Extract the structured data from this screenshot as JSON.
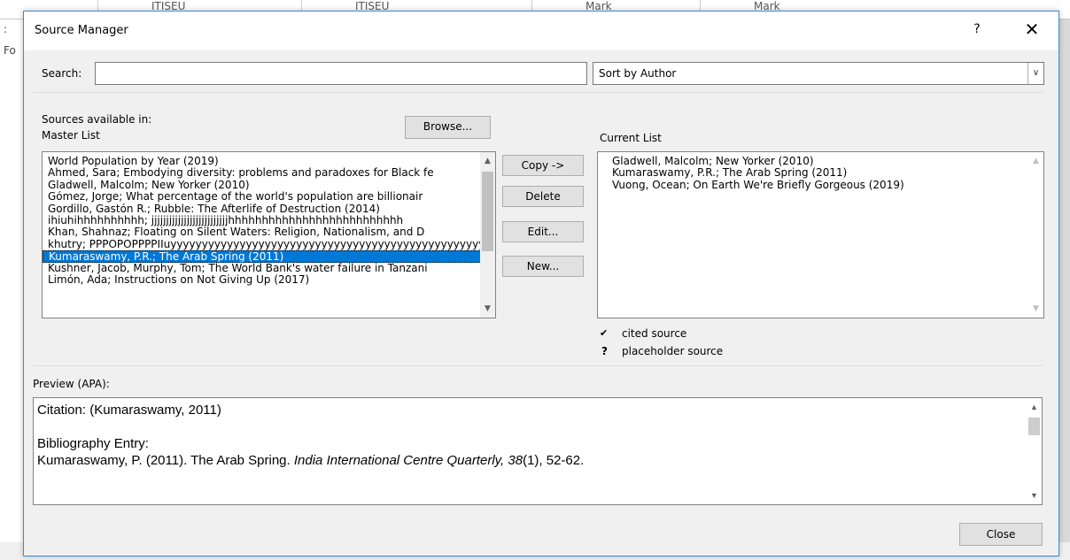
{
  "background": {
    "header_cells": [
      "ITISEU",
      "ITISEU",
      "Mark",
      "Mark"
    ],
    "left_letters": [
      ":",
      "Fo"
    ]
  },
  "dialog": {
    "title": "Source Manager",
    "help": "?",
    "close_glyph": "✕"
  },
  "search": {
    "label": "Search:",
    "value": "",
    "placeholder": ""
  },
  "sort": {
    "selected": "Sort by Author"
  },
  "master": {
    "sources_label": "Sources available in:",
    "list_label": "Master List",
    "browse_button": "Browse...",
    "items": [
      "World Population by Year (2019)",
      "Ahmed, Sara; Embodying diversity: problems and paradoxes for Black fe",
      "Gladwell, Malcolm; New Yorker (2010)",
      "Gómez, Jorge; What percentage of the world's population are billionair",
      "Gordillo, Gastón R.; Rubble: The Afterlife of Destruction (2014)",
      "ihiuhihhhhhhhhhh; jjjjjjjjjjjjjjjjjjjjjjjjjjhhhhhhhhhhhhhhhhhhhhhhhhhh",
      "Khan, Shahnaz; Floating on Silent Waters: Religion, Nationalism, and D",
      "khutry; PPPOPOPPPPIIuyyyyyyyyyyyyyyyyyyyyyyyyyyyyyyyyyyyyyyyyyyyyyyyyyy",
      "Kumaraswamy, P.R.; The Arab Spring (2011)",
      "Kushner, Jacob, Murphy, Tom; The World Bank's water failure in Tanzani",
      "Limón, Ada; Instructions on Not Giving Up (2017)"
    ],
    "selected_index": 8
  },
  "actions": {
    "copy": "Copy ->",
    "delete": "Delete",
    "edit": "Edit...",
    "new": "New..."
  },
  "current": {
    "list_label": "Current List",
    "items": [
      "Gladwell, Malcolm; New Yorker (2010)",
      "Kumaraswamy, P.R.; The Arab Spring (2011)",
      "Vuong, Ocean; On Earth We're Briefly Gorgeous (2019)"
    ]
  },
  "legend": {
    "cited_symbol": "✔",
    "cited_label": "cited source",
    "placeholder_symbol": "?",
    "placeholder_label": "placeholder source"
  },
  "preview": {
    "label": "Preview (APA):",
    "citation": "Citation:  (Kumaraswamy, 2011)",
    "bibliography_heading": "Bibliography Entry:",
    "entry_prefix": "Kumaraswamy, P. (2011). The Arab Spring. ",
    "entry_journal": "India International Centre Quarterly, 38",
    "entry_suffix": "(1), 52-62."
  },
  "close_button": "Close",
  "colors": {
    "selection": "#0078d7",
    "dialog_border": "#3c8bd6"
  }
}
